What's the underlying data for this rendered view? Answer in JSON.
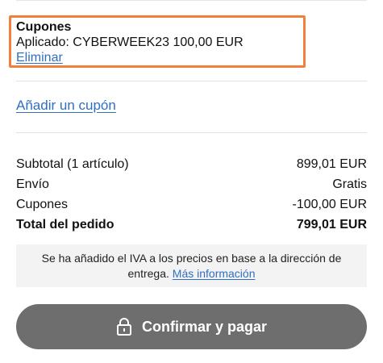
{
  "coupon": {
    "title": "Cupones",
    "applied_text": "Aplicado: CYBERWEEK23 100,00 EUR",
    "remove_label": "Eliminar"
  },
  "add_coupon_label": "Añadir un cupón",
  "summary": {
    "rows": [
      {
        "label": "Subtotal (1 artículo)",
        "value": "899,01 EUR"
      },
      {
        "label": "Envío",
        "value": "Gratis"
      },
      {
        "label": "Cupones",
        "value": "-100,00 EUR"
      }
    ],
    "total": {
      "label": "Total del pedido",
      "value": "799,01 EUR"
    }
  },
  "vat_notice": {
    "text": "Se ha añadido el IVA a los precios en base a la dirección de entrega.",
    "link_label": "Más información"
  },
  "confirm_button": {
    "label": "Confirmar y pagar",
    "icon": "lock-icon"
  },
  "colors": {
    "highlight": "#f0803c",
    "link": "#2f6fc0",
    "button_bg": "#6e6e6e"
  }
}
